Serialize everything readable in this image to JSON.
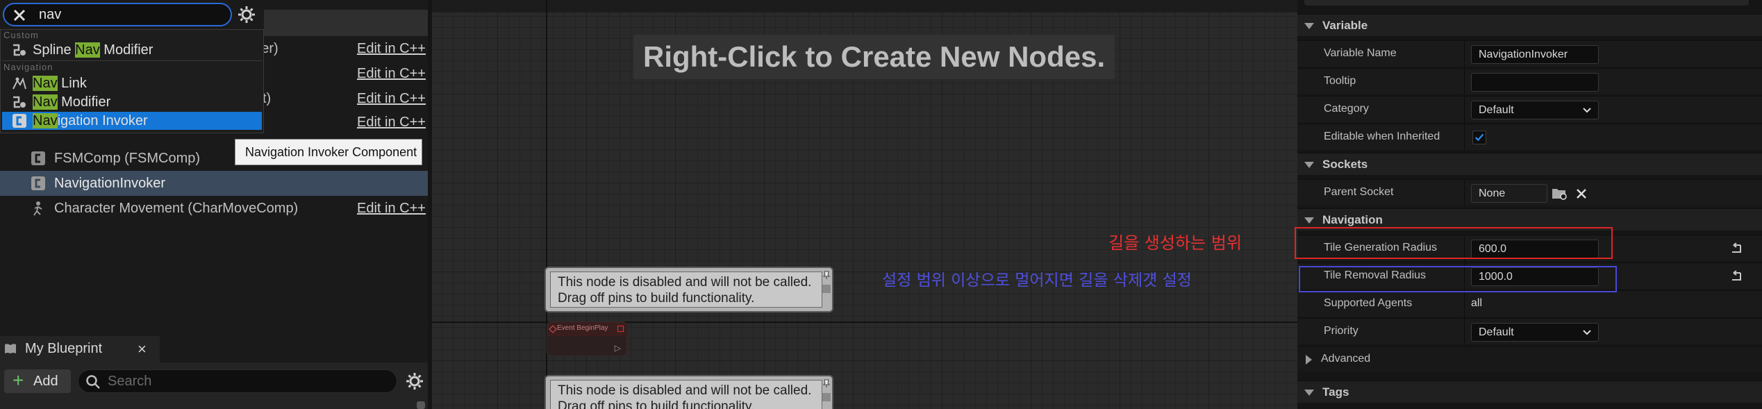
{
  "search": {
    "value": "nav"
  },
  "dropdown": {
    "category_custom": "Custom",
    "category_navigation": "Navigation",
    "items": [
      {
        "prefix": "Spline ",
        "highlight": "Nav",
        "suffix": " Modifier"
      },
      {
        "prefix": "",
        "highlight": "Nav",
        "suffix": " Link"
      },
      {
        "prefix": "",
        "highlight": "Nav",
        "suffix": " Modifier"
      },
      {
        "prefix": "",
        "highlight": "Nav",
        "suffix": "igation Invoker"
      }
    ]
  },
  "tooltip": {
    "text": "Navigation Invoker Component"
  },
  "components": {
    "partial_rows": [
      {
        "partial_label": "nder)",
        "edit": "Edit in C++"
      },
      {
        "partial_label": "",
        "edit": "Edit in C++"
      },
      {
        "partial_label": "t)",
        "edit": "Edit in C++"
      },
      {
        "partial_label": "",
        "edit": "Edit in C++"
      }
    ],
    "rows": [
      {
        "label": "FSMComp (FSMComp)",
        "edit": ""
      },
      {
        "label": "NavigationInvoker",
        "edit": ""
      },
      {
        "label": "Character Movement (CharMoveComp)",
        "edit": "Edit in C++"
      }
    ]
  },
  "my_blueprint": {
    "title": "My Blueprint",
    "close": "×",
    "add_label": "Add",
    "search_placeholder": "Search"
  },
  "graph": {
    "hint": "Right-Click to Create New Nodes.",
    "disabled_note_line1": "This node is disabled and will not be called.",
    "disabled_note_line2": "Drag off pins to build functionality.",
    "event_node_title": "Event BeginPlay"
  },
  "details": {
    "sections": {
      "variable": "Variable",
      "sockets": "Sockets",
      "navigation": "Navigation",
      "advanced": "Advanced",
      "tags": "Tags"
    },
    "variable_name_label": "Variable Name",
    "variable_name_value": "NavigationInvoker",
    "tooltip_label": "Tooltip",
    "tooltip_value": "",
    "category_label": "Category",
    "category_value": "Default",
    "editable_label": "Editable when Inherited",
    "editable_checked": true,
    "parent_socket_label": "Parent Socket",
    "parent_socket_value": "None",
    "tile_gen_label": "Tile Generation Radius",
    "tile_gen_value": "600.0",
    "tile_rem_label": "Tile Removal Radius",
    "tile_rem_value": "1000.0",
    "supported_agents_label": "Supported Agents",
    "supported_agents_value": "all",
    "priority_label": "Priority",
    "priority_value": "Default"
  },
  "annotations": {
    "red_text": "길을 생성하는 범위",
    "blue_text": "설정 범위 이상으로 멀어지면 길을 삭제걧 설정",
    "red_color": "#e02424",
    "blue_color": "#4848d8"
  },
  "colors": {
    "accent_blue": "#1476d6",
    "search_highlight": "#7cae32"
  }
}
